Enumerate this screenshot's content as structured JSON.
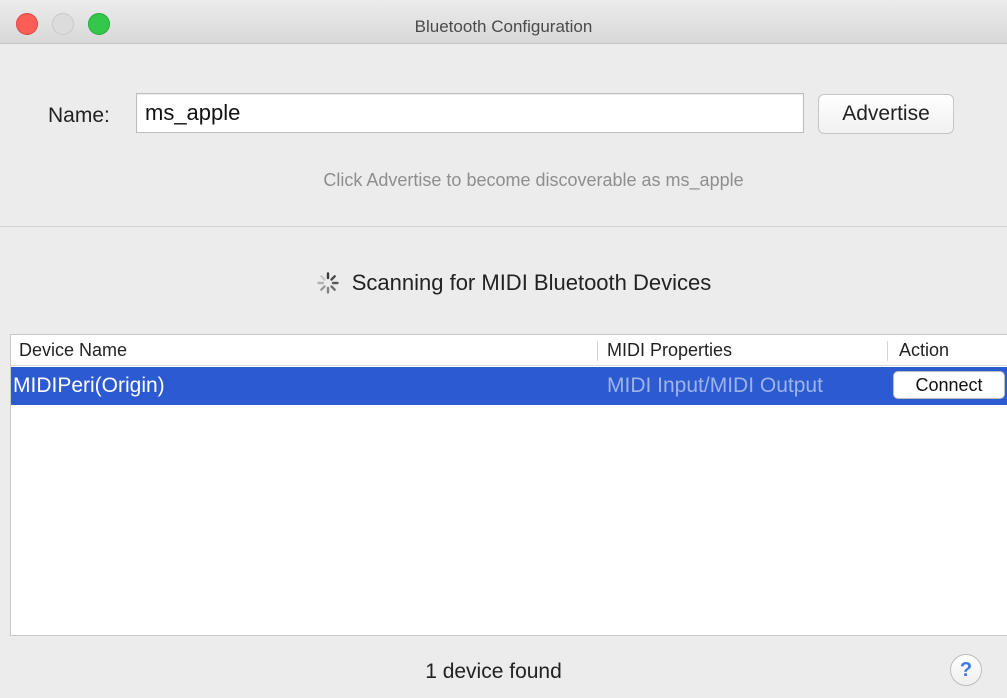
{
  "window": {
    "title": "Bluetooth Configuration"
  },
  "advertise": {
    "name_label": "Name:",
    "name_value": "ms_apple",
    "button_label": "Advertise",
    "hint": "Click Advertise to become discoverable as ms_apple"
  },
  "scan": {
    "status_text": "Scanning for MIDI Bluetooth Devices",
    "icon": "spinner-icon"
  },
  "table": {
    "columns": [
      "Device Name",
      "MIDI Properties",
      "Action"
    ],
    "rows": [
      {
        "device_name": "MIDIPeri(Origin)",
        "midi_properties": "MIDI Input/MIDI Output",
        "action_label": "Connect",
        "selected": true
      }
    ]
  },
  "footer": {
    "status": "1 device found",
    "help_label": "?"
  },
  "colors": {
    "selection": "#2b5ad1",
    "close": "#fc5d55",
    "zoom": "#34c84a"
  }
}
